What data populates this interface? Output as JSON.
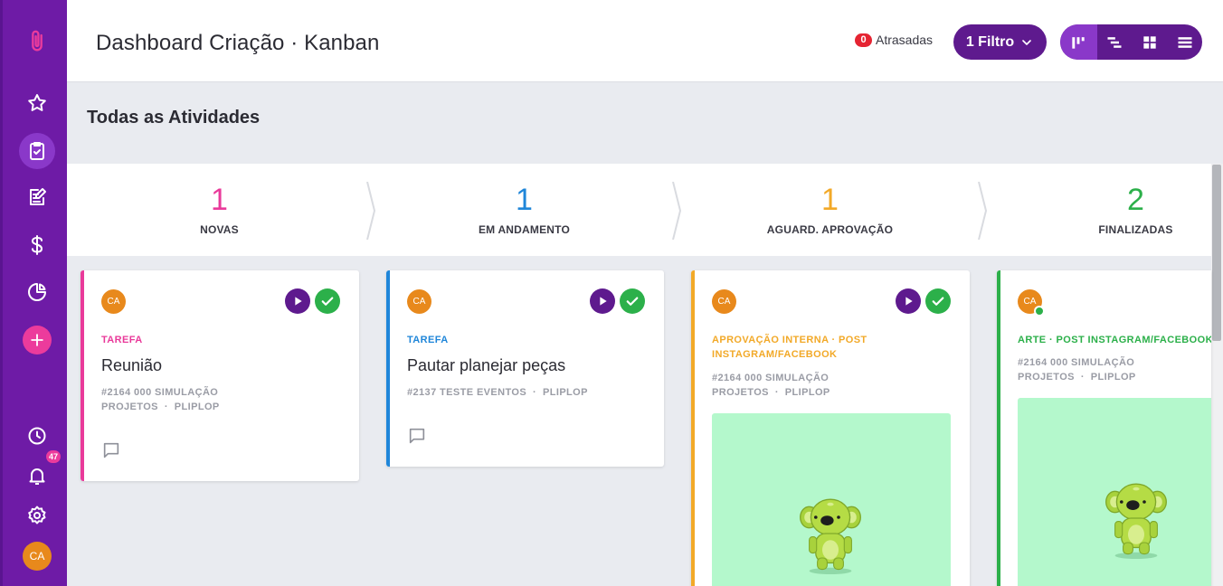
{
  "sidebar": {
    "icons": [
      "logo-clip-icon",
      "star-icon",
      "clipboard-check-icon",
      "edit-note-icon",
      "dollar-icon",
      "pie-chart-icon",
      "add-icon",
      "clock-icon",
      "bell-icon",
      "gear-icon"
    ],
    "notifications_count": "47",
    "user_initials": "CA"
  },
  "header": {
    "title": "Dashboard Criação · Kanban",
    "late_count": "0",
    "late_label": "Atrasadas",
    "filter_label": "1 Filtro",
    "views": [
      "kanban-view-icon",
      "gantt-view-icon",
      "grid-view-icon",
      "list-view-icon"
    ]
  },
  "section": {
    "title": "Todas as Atividades"
  },
  "columns": [
    {
      "count": "1",
      "label": "NOVAS",
      "color": "#e93a9a"
    },
    {
      "count": "1",
      "label": "EM ANDAMENTO",
      "color": "#1f86d9"
    },
    {
      "count": "1",
      "label": "AGUARD. APROVAÇÃO",
      "color": "#f2a928"
    },
    {
      "count": "2",
      "label": "FINALIZADAS",
      "color": "#2cb04a"
    }
  ],
  "cards": [
    {
      "avatar": "CA",
      "type": "TAREFA",
      "type_color": "#e93a9a",
      "title": "Reunião",
      "meta_line1": "#2164 000 SIMULAÇÃO",
      "meta_line2": "PROJETOS  ·  PLIPLOP"
    },
    {
      "avatar": "CA",
      "type": "TAREFA",
      "type_color": "#1f86d9",
      "title": "Pautar planejar peças",
      "meta_line1": "#2137 TESTE EVENTOS  ·  PLIPLOP"
    },
    {
      "avatar": "CA",
      "type_line1": "APROVAÇÃO INTERNA · POST",
      "type_line2": "INSTAGRAM/FACEBOOK",
      "type_color": "#f2a928",
      "meta_line1": "#2164 000 SIMULAÇÃO",
      "meta_line2": "PROJETOS  ·  PLIPLOP"
    },
    {
      "avatar": "CA",
      "type": "ARTE · POST INSTAGRAM/FACEBOOK",
      "type_color": "#2cb04a",
      "meta_line1": "#2164 000 SIMULAÇÃO",
      "meta_line2": "PROJETOS  ·  PLIPLOP"
    }
  ],
  "colors": {
    "sidebar": "#6e1ba6",
    "accent_purple": "#5e1a8e",
    "pink": "#e93a9a",
    "blue": "#1f86d9",
    "orange": "#f2a928",
    "green": "#2cb04a"
  }
}
